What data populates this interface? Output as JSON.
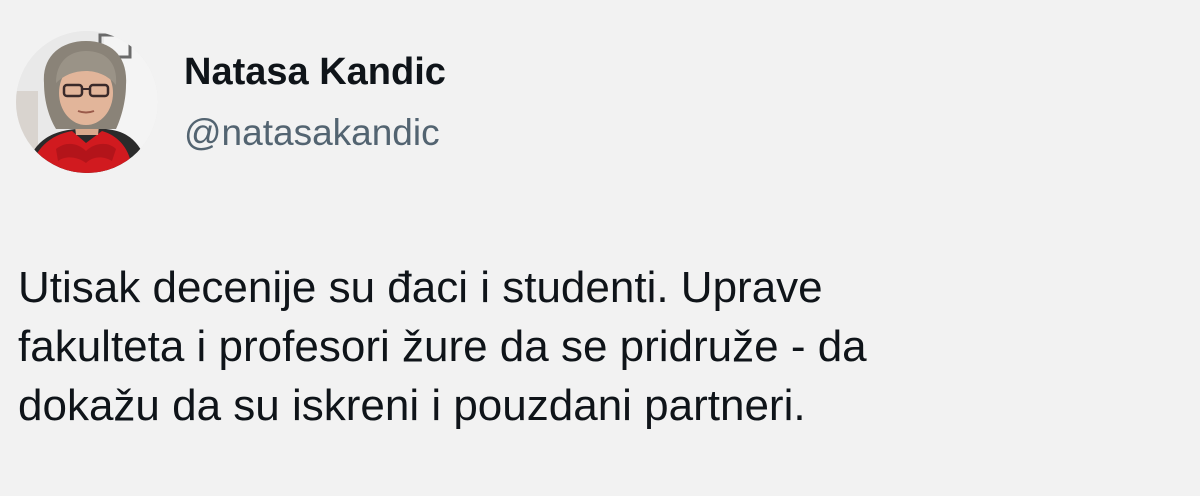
{
  "author": {
    "display_name": "Natasa Kandic",
    "handle": "@natasakandic",
    "avatar_icon": "profile-photo"
  },
  "tweet": {
    "lines": [
      "Utisak decenije su đaci i studenti. Uprave",
      "fakulteta i profesori žure da se pridruže - da",
      "dokažu da su iskreni i pouzdani partneri."
    ]
  },
  "colors": {
    "background": "#f2f2f2",
    "name_text": "#0f1419",
    "handle_text": "#536471",
    "body_text": "#0f1419"
  }
}
